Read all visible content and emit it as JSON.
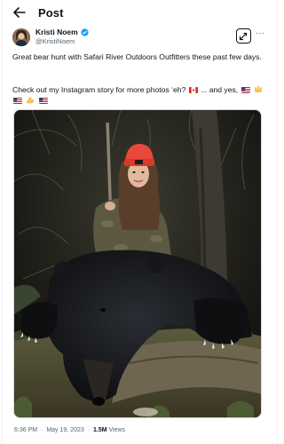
{
  "header": {
    "title": "Post"
  },
  "author": {
    "name": "Kristi Noem",
    "handle": "@KristiNoem"
  },
  "post": {
    "line1": "Great bear hunt with Safari River Outdoors Outfitters these past few days.",
    "line2_part1": "Check out my Instagram story for more photos ‘eh?",
    "line2_part2": "... and yes,",
    "image_alt": "Woman in orange beanie and camouflage holding a rifle kneeling behind a large black bear in a forest"
  },
  "meta": {
    "time": "6:36 PM",
    "date": "May 19, 2023",
    "separator": "·",
    "views_count": "1.5M",
    "views_label": "Views"
  },
  "icons": {
    "back": "back-arrow-icon",
    "verified": "verified-badge-icon",
    "subscribe": "subscribe-icon",
    "more": "more-options-icon"
  },
  "colors": {
    "text": "#0f1419",
    "secondary": "#536471",
    "verified_blue": "#1d9bf0",
    "border": "#cfd9de"
  }
}
